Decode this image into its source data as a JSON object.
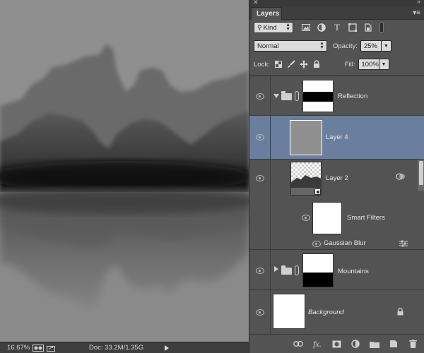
{
  "status": {
    "zoom": "16.67%",
    "doc": "Doc: 33.2M/1.35G"
  },
  "panel": {
    "tab": "Layers",
    "filter": {
      "kind_label": "Kind"
    },
    "blend_mode": "Normal",
    "opacity_label": "Opacity:",
    "opacity_value": "25%",
    "lock_label": "Lock:",
    "fill_label": "Fill:",
    "fill_value": "100%"
  },
  "layers": [
    {
      "name": "Reflection",
      "type": "group",
      "expanded": true
    },
    {
      "name": "Layer 4",
      "type": "layer",
      "selected": true
    },
    {
      "name": "Layer 2",
      "type": "smart-object"
    },
    {
      "name": "Smart Filters",
      "type": "smart-filters"
    },
    {
      "name": "Gaussian Blur",
      "type": "filter"
    },
    {
      "name": "Mountains",
      "type": "group",
      "expanded": false
    },
    {
      "name": "Background",
      "type": "background",
      "locked": true
    }
  ],
  "colors": {
    "panel_bg": "#535353",
    "selected_row": "#6a7f9d",
    "canvas_bg": "#8f8f8f"
  }
}
